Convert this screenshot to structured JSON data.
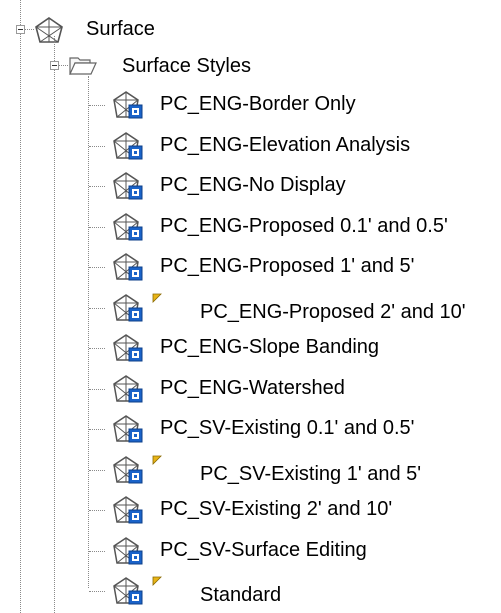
{
  "tree": {
    "root": {
      "label": "Surface",
      "icon": "surface-icon"
    },
    "folder": {
      "label": "Surface Styles",
      "icon": "folder-open-icon"
    },
    "styles": [
      {
        "label": "PC_ENG-Border Only",
        "icon": "surface-style-icon",
        "in_use": false
      },
      {
        "label": "PC_ENG-Elevation Analysis",
        "icon": "surface-style-icon",
        "in_use": false
      },
      {
        "label": "PC_ENG-No Display",
        "icon": "surface-style-icon",
        "in_use": false
      },
      {
        "label": "PC_ENG-Proposed 0.1' and 0.5'",
        "icon": "surface-style-icon",
        "in_use": false
      },
      {
        "label": "PC_ENG-Proposed 1' and 5'",
        "icon": "surface-style-icon",
        "in_use": false
      },
      {
        "label": "PC_ENG-Proposed 2' and 10'",
        "icon": "surface-style-icon",
        "in_use": true
      },
      {
        "label": "PC_ENG-Slope Banding",
        "icon": "surface-style-icon",
        "in_use": false
      },
      {
        "label": "PC_ENG-Watershed",
        "icon": "surface-style-icon",
        "in_use": false
      },
      {
        "label": "PC_SV-Existing 0.1' and 0.5'",
        "icon": "surface-style-icon",
        "in_use": false
      },
      {
        "label": "PC_SV-Existing 1' and 5'",
        "icon": "surface-style-icon",
        "in_use": true
      },
      {
        "label": "PC_SV-Existing 2' and 10'",
        "icon": "surface-style-icon",
        "in_use": false
      },
      {
        "label": "PC_SV-Surface Editing",
        "icon": "surface-style-icon",
        "in_use": false
      },
      {
        "label": "Standard",
        "icon": "surface-style-icon",
        "in_use": true
      }
    ]
  },
  "colors": {
    "in_use_marker": "#e8b417",
    "style_badge": "#1a63c9",
    "tree_line": "#8a8a8a"
  }
}
